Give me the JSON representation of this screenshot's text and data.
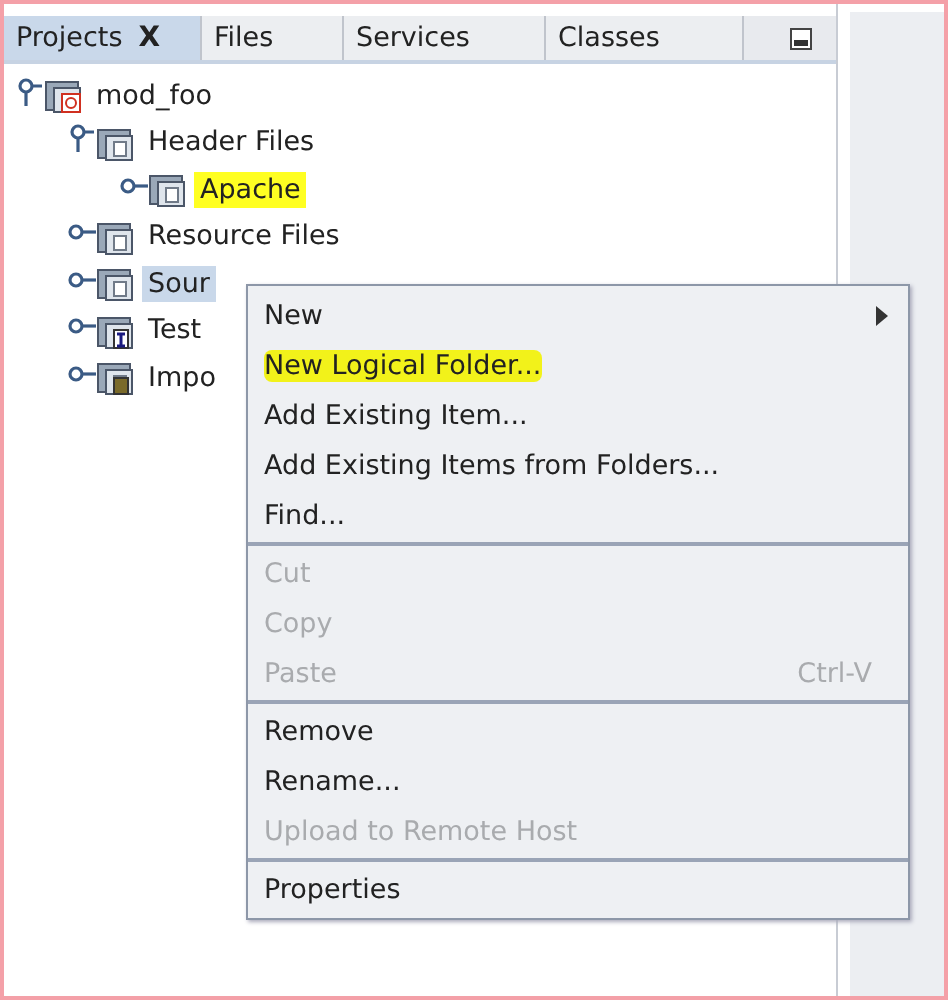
{
  "tabs": [
    {
      "label": "Projects",
      "selected": true,
      "closable": true
    },
    {
      "label": "Files",
      "selected": false,
      "closable": false
    },
    {
      "label": "Services",
      "selected": false,
      "closable": false
    },
    {
      "label": "Classes",
      "selected": false,
      "closable": false
    }
  ],
  "close_glyph": "X",
  "tree": [
    {
      "label": "mod_foo",
      "kind": "project",
      "expanded": true,
      "selected": false,
      "highlighted": false,
      "children": [
        {
          "label": "Header Files",
          "kind": "folder",
          "expanded": true,
          "selected": false,
          "highlighted": false,
          "children": [
            {
              "label": "Apache",
              "kind": "folder",
              "expanded": false,
              "selected": false,
              "highlighted": true
            }
          ]
        },
        {
          "label": "Resource Files",
          "kind": "folder",
          "expanded": false,
          "selected": false,
          "highlighted": false
        },
        {
          "label": "Sour",
          "kind": "folder",
          "expanded": false,
          "selected": true,
          "highlighted": false
        },
        {
          "label": "Test",
          "kind": "test",
          "expanded": false,
          "selected": false,
          "highlighted": false
        },
        {
          "label": "Impo",
          "kind": "import",
          "expanded": false,
          "selected": false,
          "highlighted": false
        }
      ]
    }
  ],
  "context_menu": [
    {
      "kind": "item",
      "label": "New",
      "disabled": false,
      "submenu": true,
      "highlighted": false
    },
    {
      "kind": "item",
      "label": "New Logical Folder...",
      "disabled": false,
      "submenu": false,
      "highlighted": true
    },
    {
      "kind": "item",
      "label": "Add Existing Item...",
      "disabled": false,
      "submenu": false,
      "highlighted": false
    },
    {
      "kind": "item",
      "label": "Add Existing Items from Folders...",
      "disabled": false,
      "submenu": false,
      "highlighted": false
    },
    {
      "kind": "item",
      "label": "Find...",
      "disabled": false,
      "submenu": false,
      "highlighted": false
    },
    {
      "kind": "separator"
    },
    {
      "kind": "item",
      "label": "Cut",
      "disabled": true,
      "submenu": false,
      "highlighted": false
    },
    {
      "kind": "item",
      "label": "Copy",
      "disabled": true,
      "submenu": false,
      "highlighted": false
    },
    {
      "kind": "item",
      "label": "Paste",
      "shortcut": "Ctrl-V",
      "disabled": true,
      "submenu": false,
      "highlighted": false
    },
    {
      "kind": "separator"
    },
    {
      "kind": "item",
      "label": "Remove",
      "disabled": false,
      "submenu": false,
      "highlighted": false
    },
    {
      "kind": "item",
      "label": "Rename...",
      "disabled": false,
      "submenu": false,
      "highlighted": false
    },
    {
      "kind": "item",
      "label": "Upload to Remote Host",
      "disabled": true,
      "submenu": false,
      "highlighted": false
    },
    {
      "kind": "separator"
    },
    {
      "kind": "item",
      "label": "Properties",
      "disabled": false,
      "submenu": false,
      "highlighted": false
    }
  ]
}
